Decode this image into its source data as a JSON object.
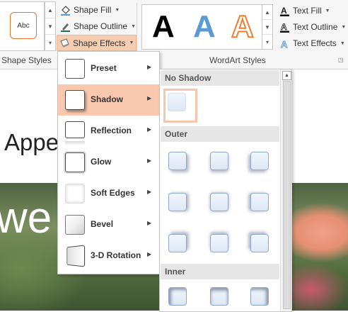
{
  "ribbon": {
    "shape_styles": {
      "sample_label": "Abc",
      "commands": {
        "shape_fill": "Shape Fill",
        "shape_outline": "Shape Outline",
        "shape_effects": "Shape Effects"
      },
      "group_label": "Shape Styles"
    },
    "wordart_styles": {
      "samples": [
        "A",
        "A",
        "A"
      ],
      "commands": {
        "text_fill": "Text Fill",
        "text_outline": "Text Outline",
        "text_effects": "Text Effects"
      },
      "group_label": "WordArt Styles"
    },
    "colors": {
      "accent_highlight": "#f7cdb2",
      "fill_bucket": "#5b9bd5",
      "outline_pen": "#217346",
      "wordart_blue": "#5b9bd5",
      "wordart_orange": "#ed7d31"
    }
  },
  "slide": {
    "title_text": "Appe",
    "photo_text": "we"
  },
  "effects_menu": {
    "items": [
      {
        "label": "Preset",
        "icon": "preset-thumb-icon",
        "has_submenu": true
      },
      {
        "label": "Shadow",
        "icon": "shadow-thumb-icon",
        "has_submenu": true,
        "active": true
      },
      {
        "label": "Reflection",
        "icon": "reflection-thumb-icon",
        "has_submenu": true
      },
      {
        "label": "Glow",
        "icon": "glow-thumb-icon",
        "has_submenu": true
      },
      {
        "label": "Soft Edges",
        "icon": "soft-edges-thumb-icon",
        "has_submenu": true
      },
      {
        "label": "Bevel",
        "icon": "bevel-thumb-icon",
        "has_submenu": true
      },
      {
        "label": "3-D Rotation",
        "icon": "3d-rotation-thumb-icon",
        "has_submenu": true
      }
    ]
  },
  "shadow_gallery": {
    "sections": {
      "no_shadow": "No Shadow",
      "outer": "Outer",
      "inner": "Inner"
    },
    "selected": "No Shadow"
  }
}
